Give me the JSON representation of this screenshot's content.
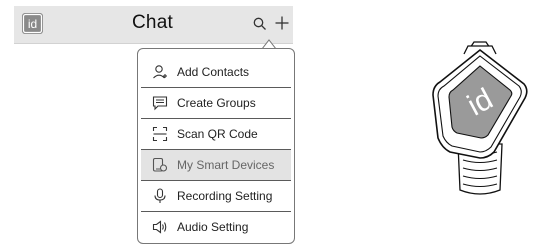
{
  "header": {
    "title": "Chat",
    "logo_text": "id",
    "icons": [
      "search-icon",
      "plus-icon"
    ]
  },
  "menu": {
    "items": [
      {
        "label": "Add Contacts",
        "icon": "add-contact-icon"
      },
      {
        "label": "Create Groups",
        "icon": "chat-group-icon"
      },
      {
        "label": "Scan QR Code",
        "icon": "qr-scan-icon"
      },
      {
        "label": "My Smart Devices",
        "icon": "smart-device-icon",
        "selected": true
      },
      {
        "label": "Recording Setting",
        "icon": "microphone-icon"
      },
      {
        "label": "Audio Setting",
        "icon": "speaker-icon"
      }
    ]
  },
  "device": {
    "logo_text": "id"
  },
  "colors": {
    "header_bg": "#e6e6e6",
    "logo_bg": "#8a8a8a",
    "selected_bg": "#e3e3e3",
    "border": "#777777"
  }
}
